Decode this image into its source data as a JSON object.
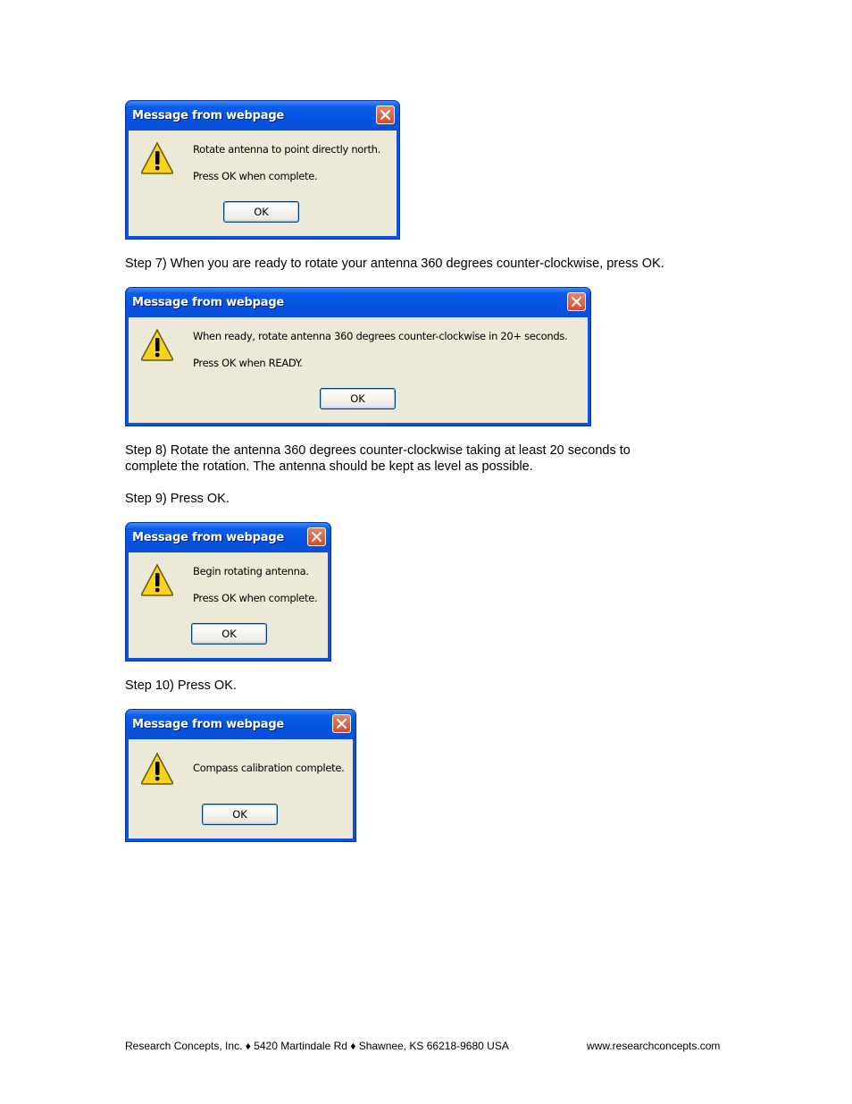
{
  "dialogs": [
    {
      "title": "Message from webpage",
      "lines": [
        "Rotate antenna to point directly north.",
        "Press OK when complete."
      ],
      "ok_label": "OK"
    },
    {
      "title": "Message from webpage",
      "lines": [
        "When ready, rotate antenna 360 degrees counter-clockwise in 20+ seconds.",
        "Press OK when READY."
      ],
      "ok_label": "OK"
    },
    {
      "title": "Message from webpage",
      "lines": [
        "Begin rotating antenna.",
        "Press OK when complete."
      ],
      "ok_label": "OK"
    },
    {
      "title": "Message from webpage",
      "lines": [
        "Compass calibration complete."
      ],
      "ok_label": "OK"
    }
  ],
  "steps": {
    "step7": "Step 7) When you are ready to rotate your antenna 360 degrees counter-clockwise, press OK.",
    "step8_line1": "Step 8) Rotate the antenna 360 degrees counter-clockwise taking at least 20 seconds to",
    "step8_line2": "complete the rotation. The antenna should be kept as level as possible.",
    "step9": "Step 9) Press OK.",
    "step10": "Step 10) Press OK."
  },
  "footer": {
    "company": "Research Concepts, Inc. ♦ 5420 Martindale Rd ♦ Shawnee, KS 66218-9680 USA",
    "website": "www.researchconcepts.com"
  },
  "colors": {
    "titlebar": "#0a54e3",
    "client": "#ece9d8",
    "close": "#d8492a",
    "warning": "#f5d10a"
  }
}
